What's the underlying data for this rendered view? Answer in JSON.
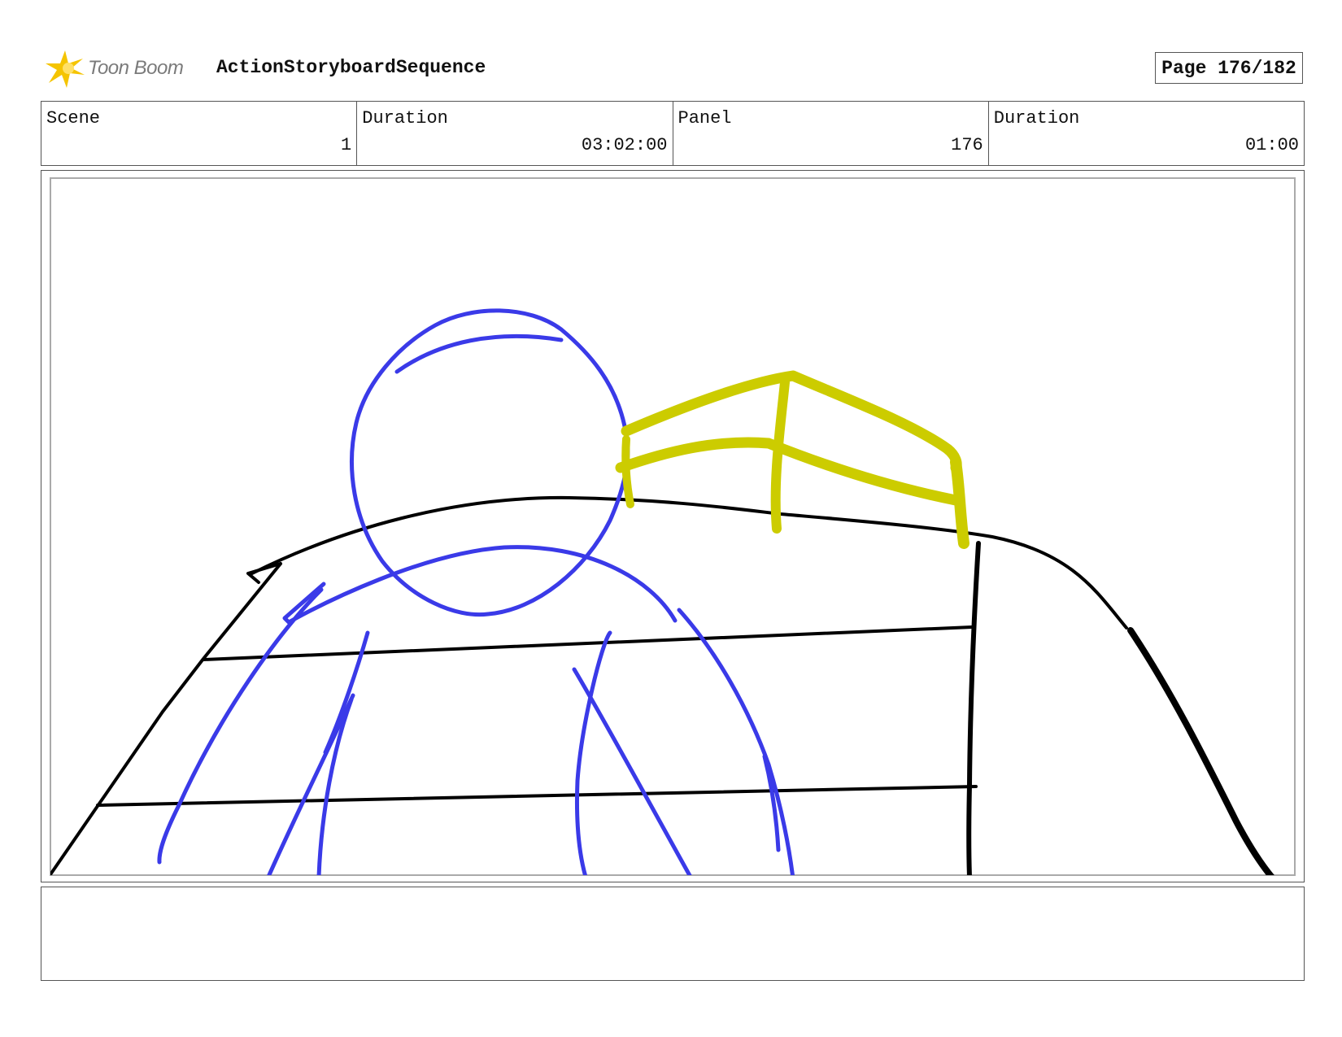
{
  "header": {
    "logo_text": "Toon Boom",
    "title": "ActionStoryboardSequence",
    "page_label": "Page 176/182"
  },
  "info": {
    "scene_label": "Scene",
    "scene_value": "1",
    "scene_duration_label": "Duration",
    "scene_duration_value": "03:02:00",
    "panel_label": "Panel",
    "panel_value": "176",
    "panel_duration_label": "Duration",
    "panel_duration_value": "01:00"
  },
  "colors": {
    "figure": "#3a3ae8",
    "helmet_marks": "#cccc00",
    "background_lines": "#000000",
    "logo_star": "#f5c400"
  },
  "notes": {
    "text": ""
  }
}
